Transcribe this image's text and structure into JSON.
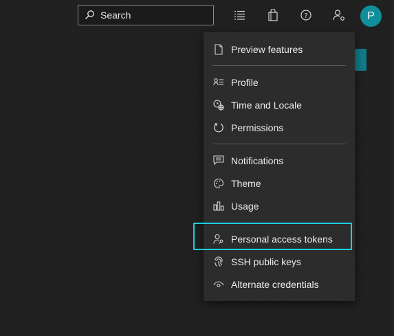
{
  "topbar": {
    "search_placeholder": "Search",
    "icons": [
      "search-icon",
      "list-icon",
      "shopping-bag-icon",
      "help-icon",
      "user-settings-icon"
    ],
    "avatar_initial": "P",
    "avatar_color": "#0f8f9c"
  },
  "menu": {
    "items": [
      {
        "label": "Preview features",
        "icon": "document-icon"
      },
      {
        "label": "Profile",
        "icon": "profile-card-icon"
      },
      {
        "label": "Time and Locale",
        "icon": "clock-globe-icon"
      },
      {
        "label": "Permissions",
        "icon": "circular-arrow-icon"
      },
      {
        "label": "Notifications",
        "icon": "comment-icon"
      },
      {
        "label": "Theme",
        "icon": "palette-icon"
      },
      {
        "label": "Usage",
        "icon": "bar-chart-icon"
      },
      {
        "label": "Personal access tokens",
        "icon": "user-key-icon"
      },
      {
        "label": "SSH public keys",
        "icon": "fingerprint-icon"
      },
      {
        "label": "Alternate credentials",
        "icon": "eye-icon"
      }
    ],
    "highlighted": "Personal access tokens",
    "highlight_color": "#19d0e0"
  }
}
